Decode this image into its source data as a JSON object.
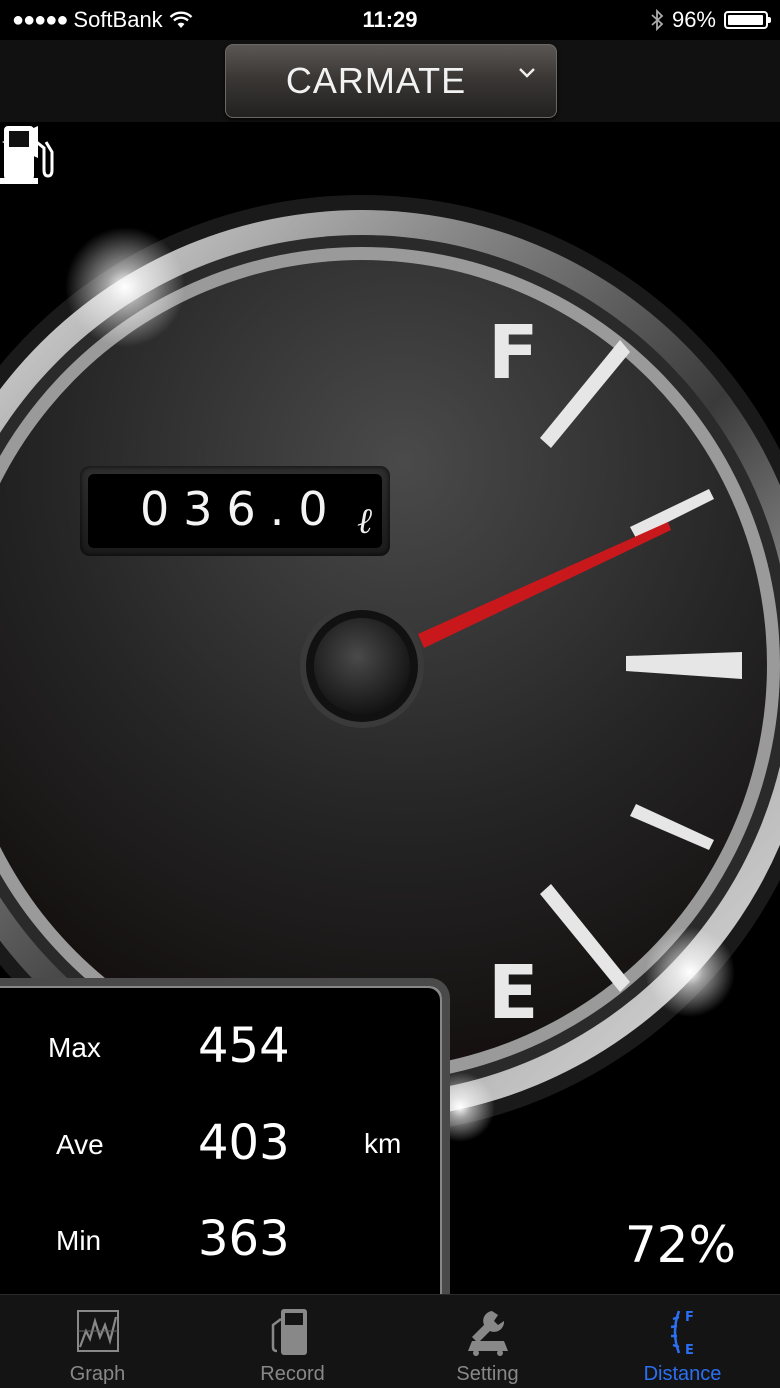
{
  "status_bar": {
    "signal_dots": "●●●●●",
    "carrier": "SoftBank",
    "time": "11:29",
    "battery_percent": "96%",
    "battery_level": 0.96
  },
  "header": {
    "selector_label": "CARMATE"
  },
  "gauge": {
    "odometer_value": "036.0",
    "odometer_unit": "ℓ",
    "full_label": "F",
    "empty_label": "E",
    "fuel_level_percent": "72%",
    "fuel_level_fraction": 0.72,
    "needle_color": "#c8181c"
  },
  "stats": {
    "max_label": "Max",
    "max_value": "454",
    "ave_label": "Ave",
    "ave_value": "403",
    "min_label": "Min",
    "min_value": "363",
    "unit": "km"
  },
  "tabs": [
    {
      "label": "Graph",
      "icon": "graph-icon",
      "active": false
    },
    {
      "label": "Record",
      "icon": "fuel-record-icon",
      "active": false
    },
    {
      "label": "Setting",
      "icon": "wrench-car-icon",
      "active": false
    },
    {
      "label": "Distance",
      "icon": "fuel-scale-icon",
      "active": true
    }
  ],
  "colors": {
    "active_tab": "#2b6ff2",
    "inactive_tab": "#888888"
  }
}
